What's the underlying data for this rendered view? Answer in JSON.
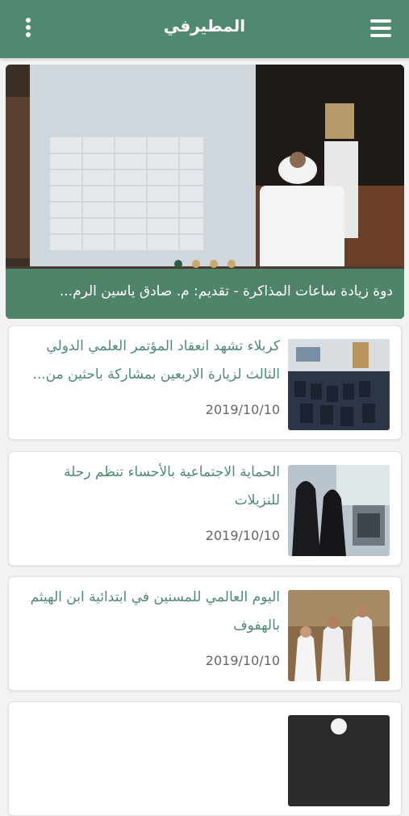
{
  "app": {
    "title": "المطيرفي"
  },
  "slider": {
    "caption": "دوة زيادة ساعات المذاكرة - تقديم: م. صادق ياسين الرم...",
    "dot_count": 4,
    "active_index": 0
  },
  "news": [
    {
      "headline": "كربلاء تشهد انعقاد المؤتمر العلمي الدولي الثالث لزيارة الاربعين بمشاركة باحثين من...",
      "date": "2019/10/10"
    },
    {
      "headline": "الحماية الاجتماعية بالأحساء تنظم رحلة للنزيلات",
      "date": "2019/10/10"
    },
    {
      "headline": "اليوم العالمي للمسنين في ابتدائية ابن الهيثم بالهفوف",
      "date": "2019/10/10"
    },
    {
      "headline": "",
      "date": ""
    }
  ],
  "colors": {
    "primary": "#4f8a70",
    "dot_inactive": "#c9a96e",
    "dot_active": "#2e5a48"
  },
  "icons": {
    "menu": "hamburger-menu-icon",
    "more": "vertical-dots-icon"
  }
}
